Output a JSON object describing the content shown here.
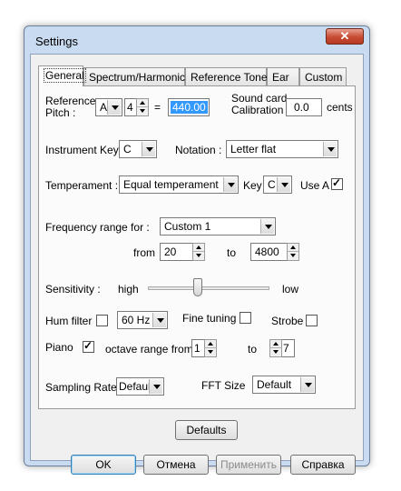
{
  "window": {
    "title": "Settings",
    "close_label": "✕"
  },
  "tabs": [
    {
      "label": "General"
    },
    {
      "label": "Spectrum/Harmonics"
    },
    {
      "label": "Reference Tone"
    },
    {
      "label": "Ear"
    },
    {
      "label": "Custom"
    }
  ],
  "reference_pitch": {
    "label": "Reference\nPitch :",
    "note": "A",
    "octave": "4",
    "equals": "=",
    "value": "440.00"
  },
  "calibration": {
    "label": "Sound card\nCalibration :",
    "value": "0.0",
    "unit": "cents"
  },
  "instrument_key": {
    "label": "Instrument Key",
    "value": "C"
  },
  "notation": {
    "label": "Notation :",
    "value": "Letter flat"
  },
  "temperament": {
    "label": "Temperament :",
    "value": "Equal temperament",
    "key_label": "Key",
    "key_value": "C",
    "use_a_label": "Use A",
    "use_a_checked": true
  },
  "frequency": {
    "label": "Frequency range for :",
    "preset": "Custom 1",
    "from_label": "from",
    "from_value": "20",
    "to_label": "to",
    "to_value": "4800"
  },
  "sensitivity": {
    "label": "Sensitivity :",
    "high_label": "high",
    "low_label": "low",
    "level": 0.4
  },
  "hum_filter": {
    "label": "Hum filter",
    "checked": false,
    "value": "60 Hz"
  },
  "fine_tuning": {
    "label": "Fine tuning",
    "checked": false
  },
  "strobe": {
    "label": "Strobe",
    "checked": false
  },
  "piano": {
    "label": "Piano",
    "checked": true,
    "octave_label": "octave range from",
    "from_value": "1",
    "to_label": "to",
    "to_value": "7"
  },
  "sampling": {
    "label": "Sampling Rate",
    "value": "Default"
  },
  "fft": {
    "label": "FFT Size",
    "value": "Default"
  },
  "buttons": {
    "defaults": "Defaults",
    "ok": "OK",
    "cancel": "Отмена",
    "apply": "Применить",
    "help": "Справка"
  }
}
